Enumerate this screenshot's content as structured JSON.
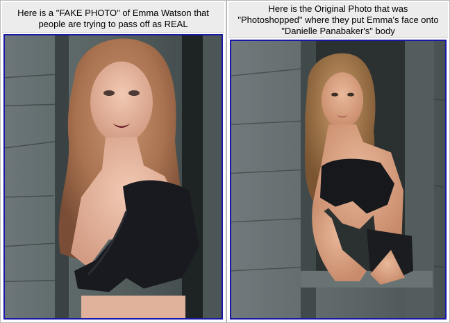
{
  "panels": [
    {
      "caption_lines": [
        "Here is a \"FAKE PHOTO\" of Emma Watson that",
        "people are trying to pass off as REAL"
      ]
    },
    {
      "caption_lines": [
        "Here is the Original Photo that was",
        "\"Photoshopped\" where they put Emma's face onto",
        "\"Danielle Panabaker's\" body"
      ]
    }
  ],
  "colors": {
    "frame_border": "#1818a8",
    "caption_bg": "#ececec",
    "wood": "#5f6b6f",
    "hair": "#b07a58"
  }
}
